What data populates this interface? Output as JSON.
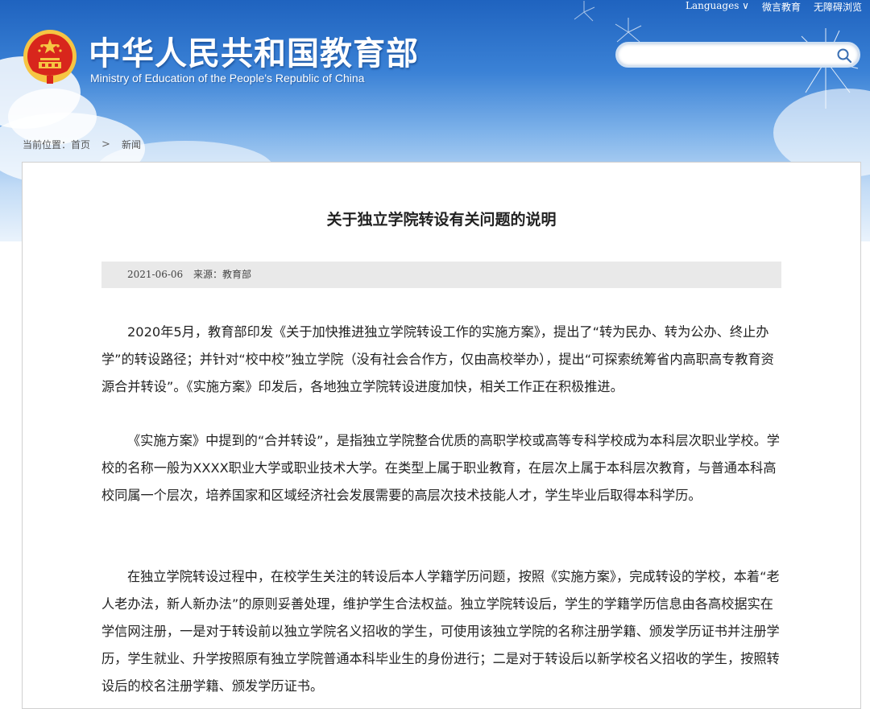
{
  "header": {
    "top_links": [
      "Languages ∨",
      "微言教育",
      "无障碍浏览"
    ],
    "site_title": "中华人民共和国教育部",
    "site_subtitle": "Ministry of Education of the People's Republic of China",
    "search_placeholder": ""
  },
  "breadcrumb": {
    "prefix": "当前位置：",
    "home": "首页",
    "separator": ">",
    "current": "新闻"
  },
  "article": {
    "title": "关于独立学院转设有关问题的说明",
    "date": "2021-06-06",
    "source": "来源：教育部",
    "paragraphs": [
      "2020年5月，教育部印发《关于加快推进独立学院转设工作的实施方案》，提出了“转为民办、转为公办、终止办学”的转设路径；并针对“校中校”独立学院（没有社会合作方，仅由高校举办），提出“可探索统筹省内高职高专教育资源合并转设”。《实施方案》印发后，各地独立学院转设进度加快，相关工作正在积极推进。",
      "《实施方案》中提到的“合并转设”，是指独立学院整合优质的高职学校或高等专科学校成为本科层次职业学校。学校的名称一般为XXXX职业大学或职业技术大学。在类型上属于职业教育，在层次上属于本科层次教育，与普通本科高校同属一个层次，培养国家和区域经济社会发展需要的高层次技术技能人才，学生毕业后取得本科学历。",
      "在独立学院转设过程中，在校学生关注的转设后本人学籍学历问题，按照《实施方案》，完成转设的学校，本着“老人老办法，新人新办法”的原则妥善处理，维护学生合法权益。独立学院转设后，学生的学籍学历信息由各高校据实在学信网注册，一是对于转设前以独立学院名义招收的学生，可使用该独立学院的名称注册学籍、颁发学历证书并注册学历，学生就业、升学按照原有独立学院普通本科毕业生的身份进行；二是对于转设后以新学校名义招收的学生，按照转设后的校名注册学籍、颁发学历证书。"
    ]
  },
  "colors": {
    "banner_top": "#1f63bf",
    "emblem_red": "#d8261c",
    "emblem_gold": "#f6c543",
    "meta_bg": "#e9e9e9"
  }
}
